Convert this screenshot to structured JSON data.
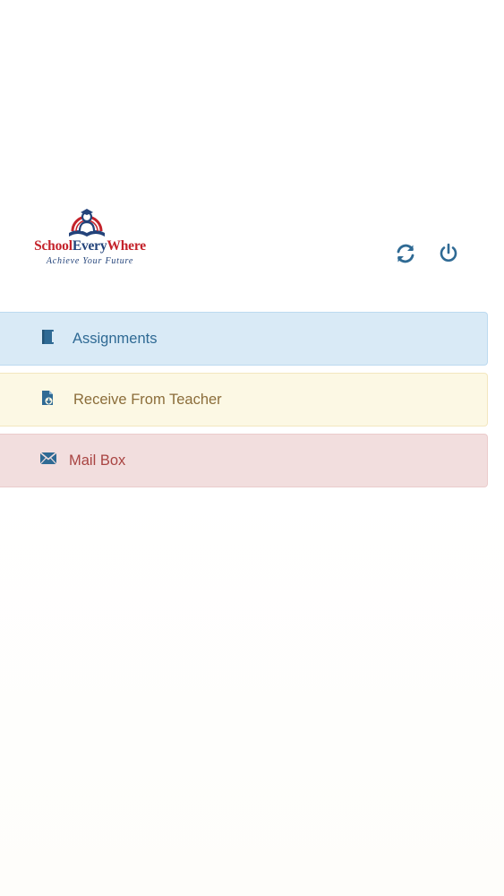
{
  "logo": {
    "name_part1": "School",
    "name_part2": "Every",
    "name_part3": "Where",
    "tagline": "Achieve Your Future"
  },
  "toolbar": {
    "refresh_icon": "refresh-icon",
    "power_icon": "power-icon"
  },
  "menu": {
    "items": [
      {
        "label": "Assignments",
        "icon": "book-icon",
        "color": "#2f6a94",
        "background": "#d9eaf6"
      },
      {
        "label": "Receive From Teacher",
        "icon": "file-download-icon",
        "color": "#8b6d3a",
        "background": "#fcf8e4"
      },
      {
        "label": "Mail Box",
        "icon": "envelope-icon",
        "color": "#a94442",
        "background": "#f2dede"
      }
    ]
  },
  "colors": {
    "brand_red": "#c4232b",
    "brand_blue": "#23437a",
    "icon_blue": "#2f6a94"
  }
}
